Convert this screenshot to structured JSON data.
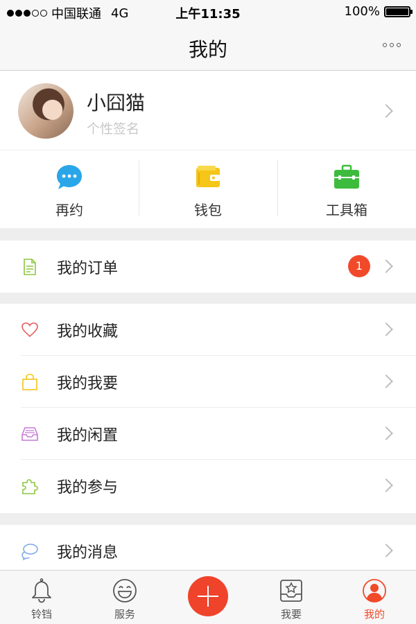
{
  "status_bar": {
    "carrier": "中国联通",
    "network": "4G",
    "time": "上午11:35",
    "battery": "100%"
  },
  "nav": {
    "title": "我的"
  },
  "profile": {
    "name": "小囧猫",
    "signature": "个性签名"
  },
  "quick_actions": [
    {
      "label": "再约",
      "icon": "chat-bubble-icon",
      "color": "#29a6e8"
    },
    {
      "label": "钱包",
      "icon": "wallet-icon",
      "color": "#f5c518"
    },
    {
      "label": "工具箱",
      "icon": "toolbox-icon",
      "color": "#3dbb3d"
    }
  ],
  "menu": {
    "orders": {
      "label": "我的订单",
      "badge": "1",
      "icon": "document-icon",
      "color": "#8cc63f"
    },
    "favorites": {
      "label": "我的收藏",
      "icon": "heart-icon",
      "color": "#e85a5a"
    },
    "wants": {
      "label": "我的我要",
      "icon": "bag-icon",
      "color": "#f5c518"
    },
    "idle": {
      "label": "我的闲置",
      "icon": "tray-icon",
      "color": "#c77ad6"
    },
    "participation": {
      "label": "我的参与",
      "icon": "puzzle-icon",
      "color": "#8cc63f"
    },
    "messages": {
      "label": "我的消息",
      "icon": "chat-bubbles-icon",
      "color": "#7aa8e8"
    }
  },
  "tab_bar": [
    {
      "label": "铃铛",
      "icon": "bell-icon"
    },
    {
      "label": "服务",
      "icon": "smiley-icon"
    },
    {
      "label": "",
      "icon": "plus-icon"
    },
    {
      "label": "我要",
      "icon": "star-box-icon"
    },
    {
      "label": "我的",
      "icon": "user-icon",
      "active": true
    }
  ],
  "colors": {
    "accent": "#f04a2a",
    "background_gap": "#eeeeee"
  }
}
